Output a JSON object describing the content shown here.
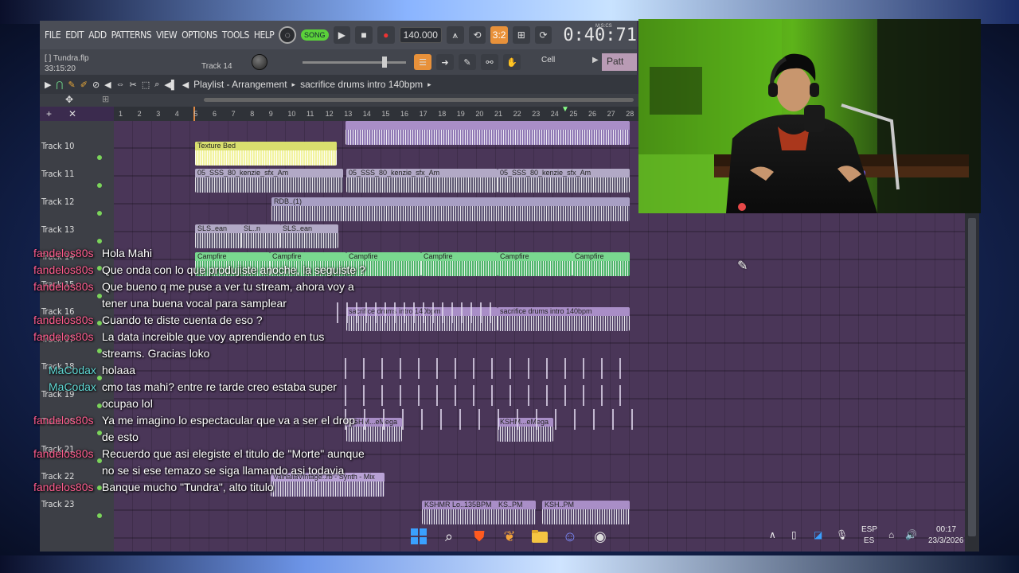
{
  "fl": {
    "menu": [
      "FILE",
      "EDIT",
      "ADD",
      "PATTERNS",
      "VIEW",
      "OPTIONS",
      "TOOLS",
      "HELP"
    ],
    "song_label": "SONG",
    "tempo": "140.000",
    "time": "0:40:71",
    "time_unit": "M:S:CS",
    "file_name": "[ ] Tundra.flp",
    "elapsed": "33:15:20",
    "track_label": "Track 14",
    "snap": "Cell",
    "pattern_label": "Patt",
    "playlist_title": "Playlist - Arrangement",
    "playlist_pattern": "sacrifice drums intro 140bpm",
    "ruler_numbers": [
      "1",
      "2",
      "3",
      "4",
      "5",
      "6",
      "7",
      "8",
      "9",
      "10",
      "11",
      "12",
      "13",
      "14",
      "15",
      "16",
      "17",
      "18",
      "19",
      "20",
      "21",
      "22",
      "23",
      "24",
      "25",
      "26",
      "27",
      "28"
    ],
    "tracks": [
      {
        "label": "Track 10"
      },
      {
        "label": "Track 11"
      },
      {
        "label": "Track 12"
      },
      {
        "label": "Track 13"
      },
      {
        "label": "Track 14"
      },
      {
        "label": "Track 15"
      },
      {
        "label": "Track 16"
      },
      {
        "label": "Track 17"
      },
      {
        "label": "Track 18"
      },
      {
        "label": "Track 19"
      },
      {
        "label": "Track 20"
      },
      {
        "label": "Track 21"
      },
      {
        "label": "Track 22"
      },
      {
        "label": "Track 23"
      }
    ],
    "clips": {
      "texture_bed": "Texture Bed",
      "sfx": "05_SSS_80_kenzie_sfx_Am",
      "rdb": "RDB..(1)",
      "sls": "SLS..ean",
      "sl": "SL..n",
      "campfire": "Campfire",
      "sacrifice": "sacrifice drums intro 140bpm",
      "kshm": "KSHM...eMega",
      "valhalla": "ValhallaVintage..rb - Synth - Mix",
      "kshmr_lo": "KSHMR Lo..135BPM",
      "ks_pm": "KS..PM",
      "ksh_pm": "KSH..PM"
    }
  },
  "chat": [
    {
      "user": "fandelos80s",
      "text": "Hola Mahi"
    },
    {
      "user": "fandelos80s",
      "text": "Que onda con lo que produjiste anoche, la seguiste ?"
    },
    {
      "user": "fandelos80s",
      "text": "Que bueno q me puse a ver tu stream, ahora voy a tener una buena vocal para samplear"
    },
    {
      "user": "fandelos80s",
      "text": "Cuando te diste cuenta de eso ?"
    },
    {
      "user": "fandelos80s",
      "text": "La data increible que voy aprendiendo en tus streams. Gracias loko"
    },
    {
      "user": "MaCodax",
      "text": "holaaa"
    },
    {
      "user": "MaCodax",
      "text": "cmo tas mahi? entre re tarde creo estaba super ocupao lol"
    },
    {
      "user": "fandelos80s",
      "text": "Ya me imagino lo espectacular que va a ser el drop de esto"
    },
    {
      "user": "fandelos80s",
      "text": "Recuerdo que asi elegiste el titulo de \"Morte\" aunque no se si ese temazo se siga llamando asi todavia"
    },
    {
      "user": "fandelos80s",
      "text": "Banque mucho \"Tundra\", alto titulo"
    }
  ],
  "taskbar": {
    "lang1": "ESP",
    "lang2": "ES",
    "time": "00:17",
    "date": "23/3/2026"
  }
}
